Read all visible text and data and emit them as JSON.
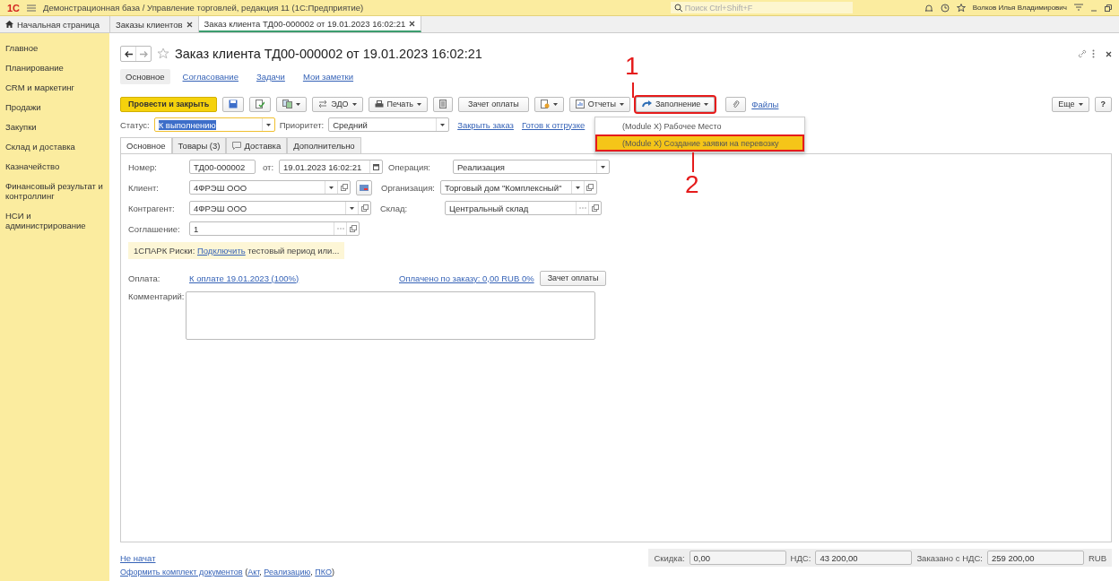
{
  "window": {
    "logo": "1С",
    "title": "Демонстрационная база / Управление торговлей, редакция 11  (1С:Предприятие)",
    "search_placeholder": "Поиск Ctrl+Shift+F",
    "user": "Волков Илья Владимирович"
  },
  "tabs": [
    {
      "label": "Начальная страница",
      "home": true,
      "selected": false
    },
    {
      "label": "Заказы клиентов",
      "home": false,
      "selected": false
    },
    {
      "label": "Заказ клиента ТД00-000002 от 19.01.2023 16:02:21",
      "home": false,
      "selected": true
    }
  ],
  "sidebar": {
    "items": [
      "Главное",
      "Планирование",
      "CRM и маркетинг",
      "Продажи",
      "Закупки",
      "Склад и доставка",
      "Казначейство",
      "Финансовый результат и контроллинг",
      "НСИ и администрирование"
    ]
  },
  "document": {
    "title": "Заказ клиента ТД00-000002 от 19.01.2023 16:02:21",
    "sections": [
      {
        "label": "Основное",
        "selected": true
      },
      {
        "label": "Согласование",
        "selected": false
      },
      {
        "label": "Задачи",
        "selected": false
      },
      {
        "label": "Мои заметки",
        "selected": false
      }
    ]
  },
  "toolbar": {
    "post_close": "Провести и закрыть",
    "edo": "ЭДО",
    "print": "Печать",
    "payment_offset": "Зачет оплаты",
    "reports": "Отчеты",
    "fill": "Заполнение",
    "files": "Файлы",
    "more": "Еще",
    "help": "?"
  },
  "fill_menu": {
    "items": [
      {
        "label": "(Module X) Рабочее Место",
        "selected": false
      },
      {
        "label": "(Module X) Создание заявки на перевозку",
        "selected": true
      }
    ]
  },
  "annotations": [
    "1",
    "2"
  ],
  "status": {
    "label": "Статус:",
    "value": "К выполнению",
    "priority_label": "Приоритет:",
    "priority_value": "Средний",
    "links": [
      "Закрыть заказ",
      "Готов к отгрузке"
    ]
  },
  "form_tabs": [
    {
      "label": "Основное",
      "selected": true
    },
    {
      "label": "Товары (3)",
      "selected": false
    },
    {
      "label": "Доставка",
      "selected": false
    },
    {
      "label": "Дополнительно",
      "selected": false
    }
  ],
  "form": {
    "number_label": "Номер:",
    "number": "ТД00-000002",
    "date_label": "от:",
    "date": "19.01.2023 16:02:21",
    "operation_label": "Операция:",
    "operation": "Реализация",
    "client_label": "Клиент:",
    "client": "4ФРЭШ ООО",
    "organization_label": "Организация:",
    "organization": "Торговый дом \"Комплексный\"",
    "counterparty_label": "Контрагент:",
    "counterparty": "4ФРЭШ ООО",
    "warehouse_label": "Склад:",
    "warehouse": "Центральный склад",
    "agreement_label": "Соглашение:",
    "agreement": "1",
    "spark": [
      {
        "kind": "text",
        "text": "1СПАРК Риски: "
      },
      {
        "kind": "link",
        "text": "Подключить"
      },
      {
        "kind": "text",
        "text": " тестовый период или..."
      }
    ],
    "payment_label": "Оплата:",
    "payment_link": "К оплате 19.01.2023 (100%)",
    "paid_link": "Оплачено по заказу: 0,00 RUB 0%",
    "payment_button": "Зачет оплаты",
    "comment_label": "Комментарий:"
  },
  "footer": {
    "state_link": "Не начат",
    "discount_label": "Скидка:",
    "discount": "0,00",
    "vat_label": "НДС:",
    "vat": "43 200,00",
    "total_label": "Заказано с НДС:",
    "total": "259 200,00",
    "currency": "RUB",
    "documents": [
      {
        "kind": "link",
        "text": "Оформить комплект документов"
      },
      {
        "kind": "text",
        "text": " ("
      },
      {
        "kind": "link",
        "text": "Акт"
      },
      {
        "kind": "text",
        "text": ", "
      },
      {
        "kind": "link",
        "text": "Реализацию"
      },
      {
        "kind": "text",
        "text": ", "
      },
      {
        "kind": "link",
        "text": "ПКО"
      },
      {
        "kind": "text",
        "text": ")"
      }
    ]
  }
}
